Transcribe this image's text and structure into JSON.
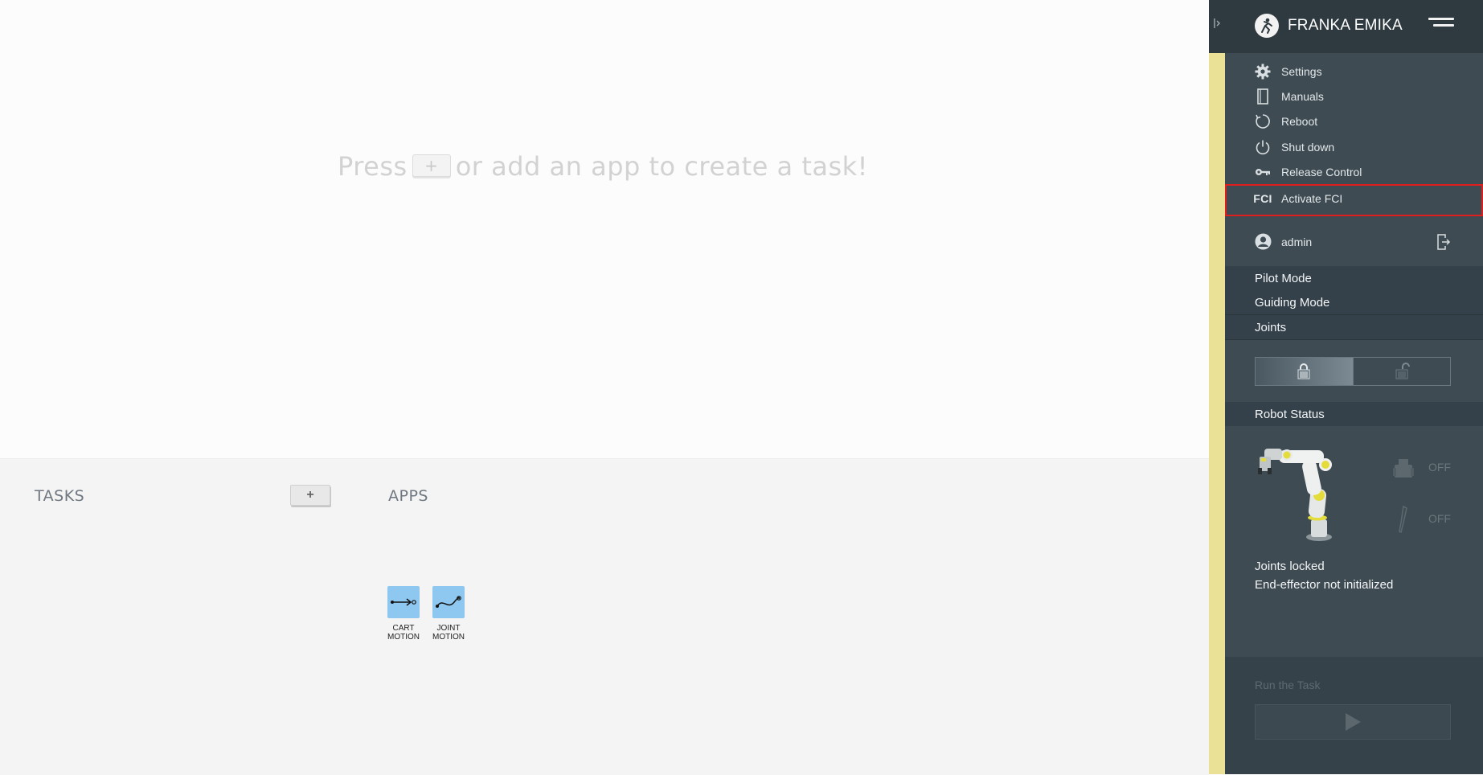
{
  "workspace": {
    "hint_before": "Press",
    "hint_plus": "+",
    "hint_after": "or add an app to create a task!"
  },
  "tasks": {
    "title": "TASKS",
    "add_label": "+"
  },
  "apps": {
    "title": "APPS",
    "items": [
      {
        "label": "CART\nMOTION",
        "icon": "cart-motion-icon"
      },
      {
        "label": "JOINT\nMOTION",
        "icon": "joint-motion-icon"
      }
    ]
  },
  "sidebar": {
    "brand": "FRANKA EMIKA",
    "menu": [
      {
        "label": "Settings",
        "icon": "gear-icon"
      },
      {
        "label": "Manuals",
        "icon": "book-icon"
      },
      {
        "label": "Reboot",
        "icon": "reboot-icon"
      },
      {
        "label": "Shut down",
        "icon": "power-icon"
      },
      {
        "label": "Release Control",
        "icon": "key-icon"
      },
      {
        "label": "Activate FCI",
        "icon_text": "FCI"
      }
    ],
    "user": {
      "name": "admin"
    },
    "modes": [
      "Pilot Mode",
      "Guiding Mode",
      "Joints"
    ],
    "robot_status": {
      "title": "Robot Status",
      "gripper_state": "OFF",
      "tool_state": "OFF",
      "line1": "Joints locked",
      "line2": "End-effector not initialized"
    },
    "run": {
      "label": "Run the Task"
    }
  },
  "colors": {
    "sidebar_bg": "#3e4b52",
    "header_bg": "#2f3a40",
    "accent_yellow": "#eae197",
    "highlight_red": "#e01e1e",
    "app_tile": "#8ec7ef"
  }
}
